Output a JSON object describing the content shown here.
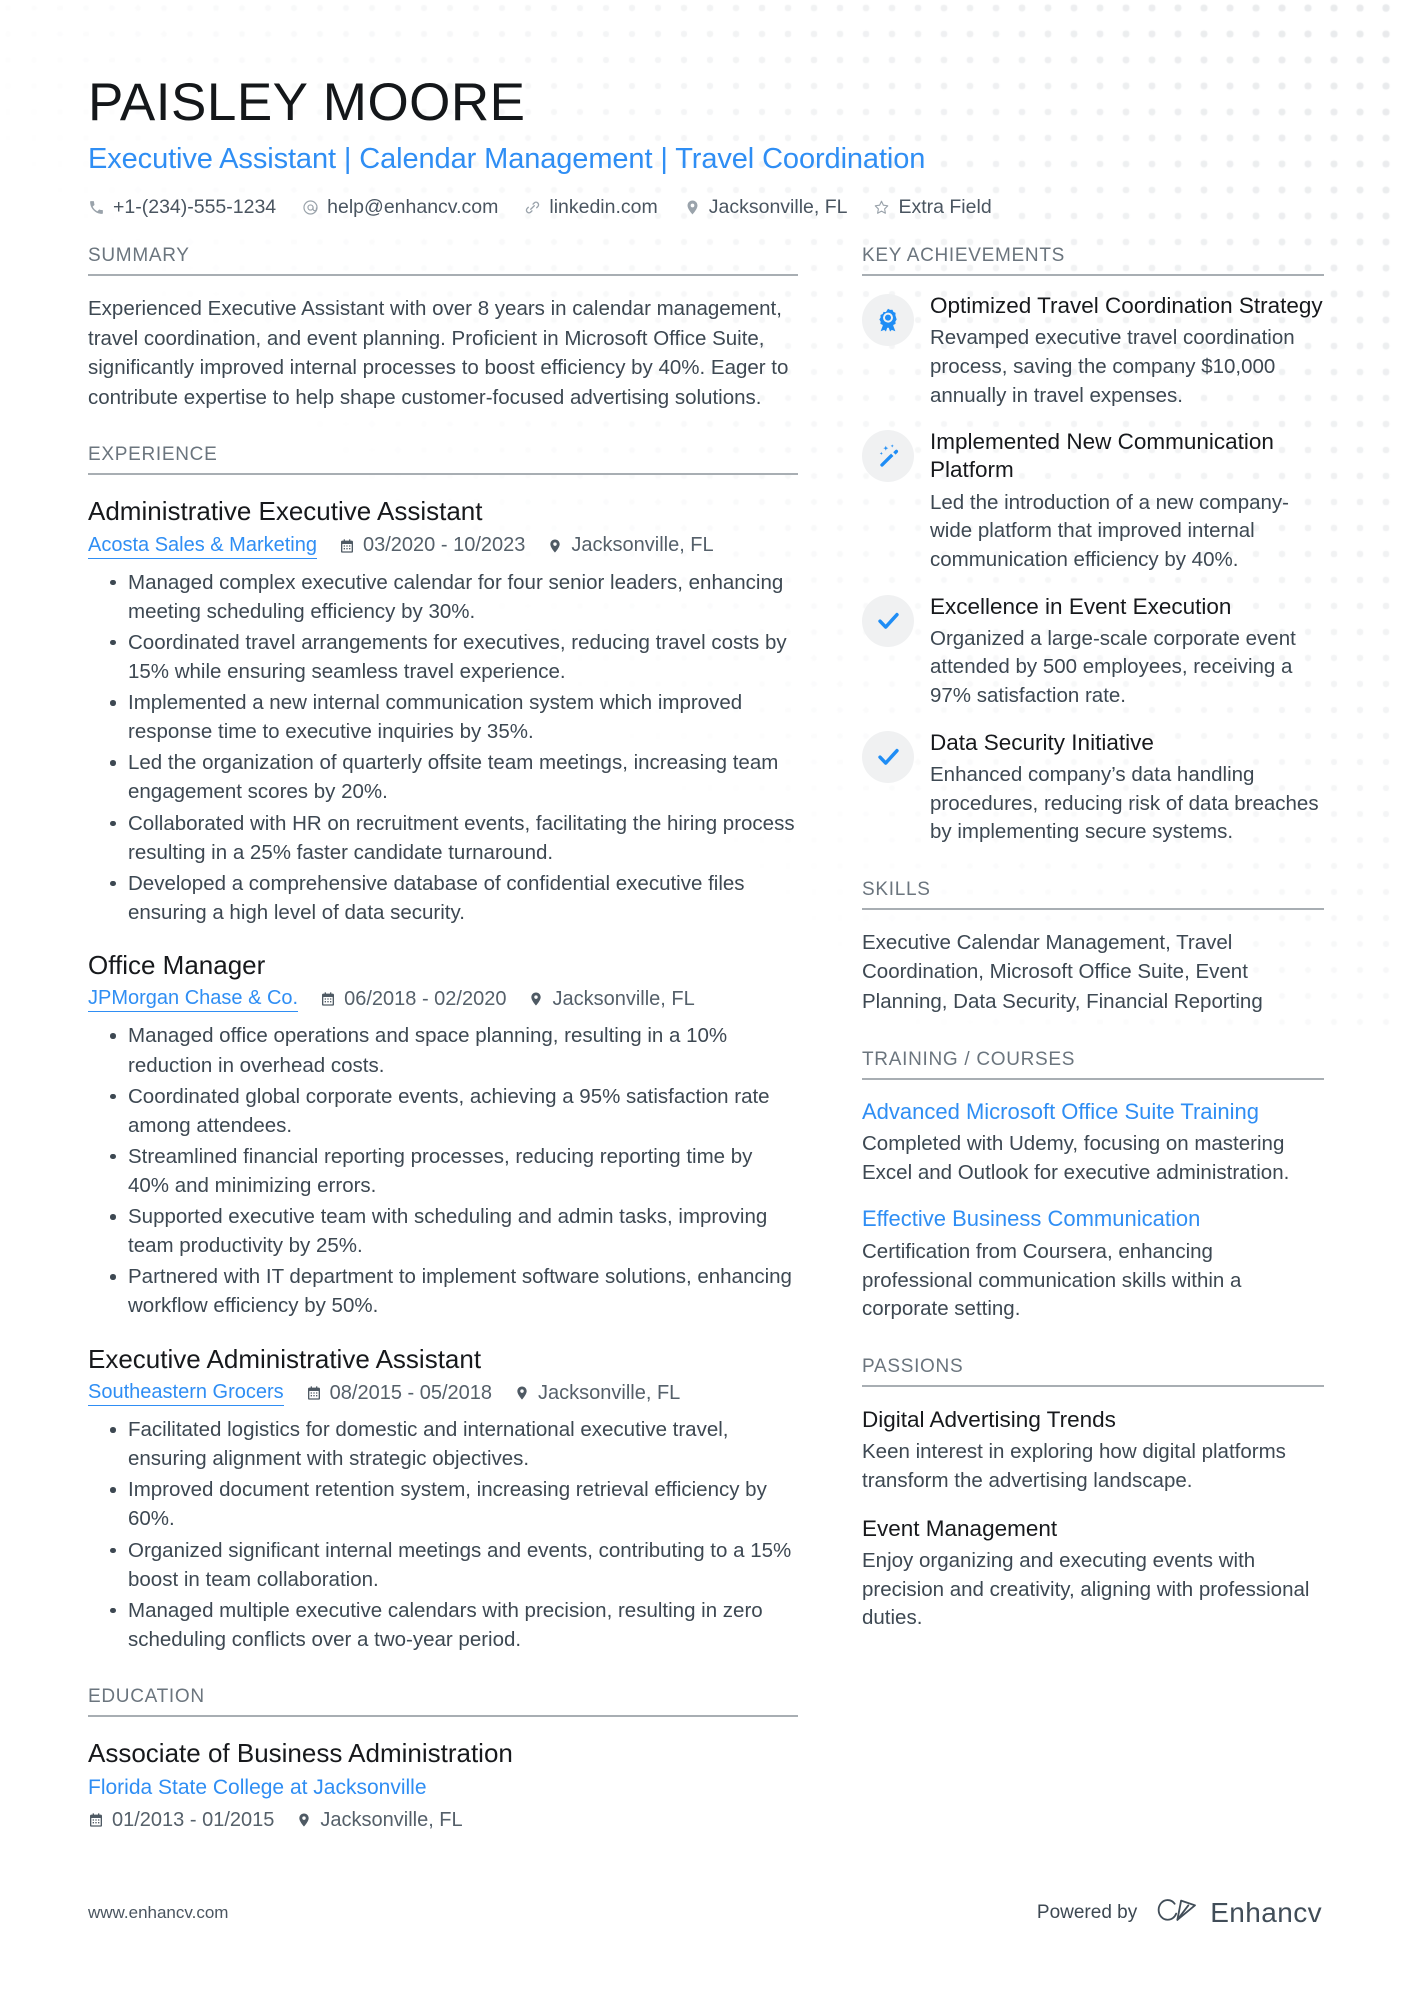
{
  "header": {
    "name": "PAISLEY MOORE",
    "headline": "Executive Assistant | Calendar Management | Travel Coordination",
    "contacts": [
      {
        "icon": "phone-icon",
        "text": "+1-(234)-555-1234"
      },
      {
        "icon": "email-icon",
        "text": "help@enhancv.com"
      },
      {
        "icon": "link-icon",
        "text": "linkedin.com"
      },
      {
        "icon": "location-pin-icon",
        "text": "Jacksonville, FL"
      },
      {
        "icon": "star-icon",
        "text": "Extra Field"
      }
    ]
  },
  "summary": {
    "heading": "SUMMARY",
    "text": "Experienced Executive Assistant with over 8 years in calendar management, travel coordination, and event planning. Proficient in Microsoft Office Suite, significantly improved internal processes to boost efficiency by 40%. Eager to contribute expertise to help shape customer-focused advertising solutions."
  },
  "experience": {
    "heading": "EXPERIENCE",
    "jobs": [
      {
        "title": "Administrative Executive Assistant",
        "company": "Acosta Sales & Marketing",
        "dates": "03/2020 - 10/2023",
        "location": "Jacksonville, FL",
        "bullets": [
          "Managed complex executive calendar for four senior leaders, enhancing meeting scheduling efficiency by 30%.",
          "Coordinated travel arrangements for executives, reducing travel costs by 15% while ensuring seamless travel experience.",
          "Implemented a new internal communication system which improved response time to executive inquiries by 35%.",
          "Led the organization of quarterly offsite team meetings, increasing team engagement scores by 20%.",
          "Collaborated with HR on recruitment events, facilitating the hiring process resulting in a 25% faster candidate turnaround.",
          "Developed a comprehensive database of confidential executive files ensuring a high level of data security."
        ]
      },
      {
        "title": "Office Manager",
        "company": "JPMorgan Chase & Co.",
        "dates": "06/2018 - 02/2020",
        "location": "Jacksonville, FL",
        "bullets": [
          "Managed office operations and space planning, resulting in a 10% reduction in overhead costs.",
          "Coordinated global corporate events, achieving a 95% satisfaction rate among attendees.",
          "Streamlined financial reporting processes, reducing reporting time by 40% and minimizing errors.",
          "Supported executive team with scheduling and admin tasks, improving team productivity by 25%.",
          "Partnered with IT department to implement software solutions, enhancing workflow efficiency by 50%."
        ]
      },
      {
        "title": "Executive Administrative Assistant",
        "company": "Southeastern Grocers",
        "dates": "08/2015 - 05/2018",
        "location": "Jacksonville, FL",
        "bullets": [
          "Facilitated logistics for domestic and international executive travel, ensuring alignment with strategic objectives.",
          "Improved document retention system, increasing retrieval efficiency by 60%.",
          "Organized significant internal meetings and events, contributing to a 15% boost in team collaboration.",
          "Managed multiple executive calendars with precision, resulting in zero scheduling conflicts over a two-year period."
        ]
      }
    ]
  },
  "education": {
    "heading": "EDUCATION",
    "entries": [
      {
        "degree": "Associate of Business Administration",
        "school": "Florida State College at Jacksonville",
        "dates": "01/2013 - 01/2015",
        "location": "Jacksonville, FL"
      }
    ]
  },
  "key_achievements": {
    "heading": "KEY ACHIEVEMENTS",
    "items": [
      {
        "icon": "award-ribbon-icon",
        "title": "Optimized Travel Coordination Strategy",
        "desc": "Revamped executive travel coordination process, saving the company $10,000 annually in travel expenses."
      },
      {
        "icon": "magic-wand-icon",
        "title": "Implemented New Communication Platform",
        "desc": "Led the introduction of a new company-wide platform that improved internal communication efficiency by 40%."
      },
      {
        "icon": "check-icon",
        "title": "Excellence in Event Execution",
        "desc": "Organized a large-scale corporate event attended by 500 employees, receiving a 97% satisfaction rate."
      },
      {
        "icon": "check-icon",
        "title": "Data Security Initiative",
        "desc": "Enhanced company’s data handling procedures, reducing risk of data breaches by implementing secure systems."
      }
    ]
  },
  "skills": {
    "heading": "SKILLS",
    "text": "Executive Calendar Management, Travel Coordination, Microsoft Office Suite, Event Planning, Data Security, Financial Reporting"
  },
  "training": {
    "heading": "TRAINING / COURSES",
    "courses": [
      {
        "title": "Advanced Microsoft Office Suite Training",
        "desc": "Completed with Udemy, focusing on mastering Excel and Outlook for executive administration."
      },
      {
        "title": "Effective Business Communication",
        "desc": "Certification from Coursera, enhancing professional communication skills within a corporate setting."
      }
    ]
  },
  "passions": {
    "heading": "PASSIONS",
    "items": [
      {
        "title": "Digital Advertising Trends",
        "desc": "Keen interest in exploring how digital platforms transform the advertising landscape."
      },
      {
        "title": "Event Management",
        "desc": "Enjoy organizing and executing events with precision and creativity, aligning with professional duties."
      }
    ]
  },
  "footer": {
    "url": "www.enhancv.com",
    "powered_by": "Powered by",
    "brand": "Enhancv"
  },
  "colors": {
    "accent": "#2f8ef4",
    "text": "#3d4852",
    "heading": "#17191c",
    "rule": "#a8aeb3"
  }
}
